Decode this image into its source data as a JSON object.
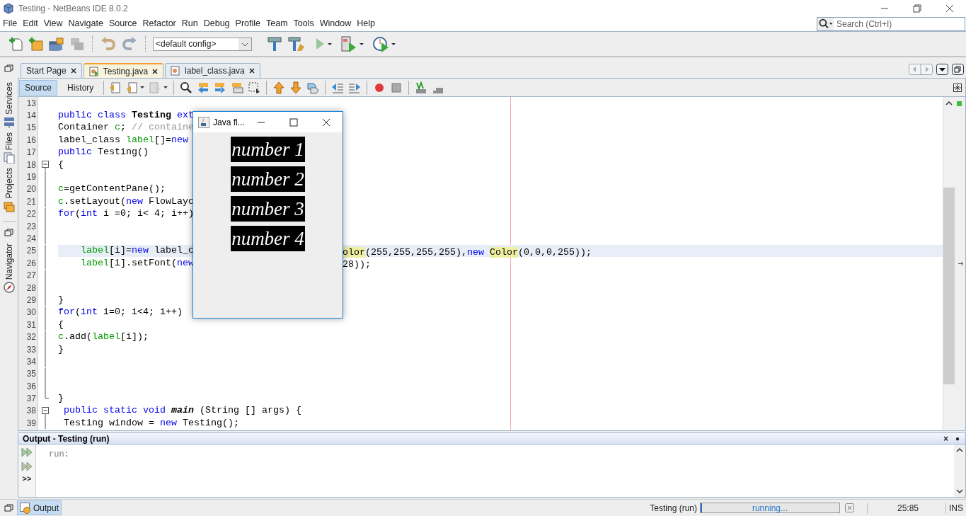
{
  "window": {
    "title": "Testing - NetBeans IDE 8.0.2"
  },
  "menu": [
    "File",
    "Edit",
    "View",
    "Navigate",
    "Source",
    "Refactor",
    "Run",
    "Debug",
    "Profile",
    "Team",
    "Tools",
    "Window",
    "Help"
  ],
  "search": {
    "placeholder": "Search (Ctrl+I)"
  },
  "toolbar": {
    "config": "<default config>"
  },
  "side_tabs": [
    {
      "label": "Services"
    },
    {
      "label": "Files"
    },
    {
      "label": "Projects"
    },
    {
      "label": "Navigator"
    }
  ],
  "editor_tabs": [
    {
      "label": "Start Page",
      "selected": false
    },
    {
      "label": "Testing.java",
      "selected": true
    },
    {
      "label": "label_class.java",
      "selected": false
    }
  ],
  "view_tabs": [
    {
      "label": "Source",
      "selected": true
    },
    {
      "label": "History",
      "selected": false
    }
  ],
  "code_lines": [
    {
      "number": "13",
      "kind": "plain",
      "current": false
    },
    {
      "number": "14",
      "kind": "plain",
      "current": false,
      "left": [
        {
          "text": "public class ",
          "kind": "kw"
        },
        {
          "text": "Testing",
          "kind": "bold"
        },
        {
          "text": " ext",
          "kind": "kw"
        }
      ]
    },
    {
      "number": "15",
      "kind": "plain",
      "current": false,
      "left": [
        {
          "text": "Container ",
          "kind": "plain"
        },
        {
          "text": "c",
          "kind": "field"
        },
        {
          "text": "; ",
          "kind": "plain"
        },
        {
          "text": "// containe",
          "kind": "comment"
        }
      ]
    },
    {
      "number": "16",
      "kind": "plain",
      "current": false,
      "left": [
        {
          "text": "label_class ",
          "kind": "plain"
        },
        {
          "text": "label",
          "kind": "field"
        },
        {
          "text": "[]=",
          "kind": "plain"
        },
        {
          "text": "new",
          "kind": "kw"
        }
      ]
    },
    {
      "number": "17",
      "kind": "plain",
      "current": false,
      "left": [
        {
          "text": "public ",
          "kind": "kw"
        },
        {
          "text": "Testing()",
          "kind": "plain"
        }
      ]
    },
    {
      "number": "18",
      "kind": "fold_start",
      "current": false,
      "left": [
        {
          "text": "{",
          "kind": "plain"
        }
      ]
    },
    {
      "number": "19",
      "kind": "fold_body",
      "current": false
    },
    {
      "number": "20",
      "kind": "fold_body",
      "current": false,
      "left": [
        {
          "text": "c",
          "kind": "field"
        },
        {
          "text": "=getContentPane();",
          "kind": "plain"
        }
      ]
    },
    {
      "number": "21",
      "kind": "fold_body",
      "current": false,
      "left": [
        {
          "text": "c",
          "kind": "field"
        },
        {
          "text": ".setLayout(",
          "kind": "plain"
        },
        {
          "text": "new",
          "kind": "kw"
        },
        {
          "text": " FlowLayo",
          "kind": "plain"
        }
      ]
    },
    {
      "number": "22",
      "kind": "fold_body",
      "current": false,
      "left": [
        {
          "text": "for",
          "kind": "kw"
        },
        {
          "text": "(",
          "kind": "plain"
        },
        {
          "text": "int",
          "kind": "kw"
        },
        {
          "text": " i =0; i< 4; i++)",
          "kind": "plain"
        }
      ]
    },
    {
      "number": "23",
      "kind": "fold_body",
      "current": false
    },
    {
      "number": "24",
      "kind": "fold_body",
      "current": false
    },
    {
      "number": "25",
      "kind": "fold_body",
      "current": true,
      "left": [
        {
          "text": "    label",
          "kind": "field"
        },
        {
          "text": "[i]=",
          "kind": "plain"
        },
        {
          "text": "new",
          "kind": "kw"
        },
        {
          "text": " label_c",
          "kind": "plain"
        }
      ],
      "right": [
        {
          "text": "olor",
          "kind": "mark"
        },
        {
          "text": "(255,255,255,255),",
          "kind": "plain"
        },
        {
          "text": "new ",
          "kind": "kw"
        },
        {
          "text": "Color",
          "kind": "mark"
        },
        {
          "text": "(0,0,0,255));",
          "kind": "plain"
        }
      ]
    },
    {
      "number": "26",
      "kind": "fold_body",
      "current": false,
      "left": [
        {
          "text": "    label",
          "kind": "field"
        },
        {
          "text": "[i].setFont(",
          "kind": "plain"
        },
        {
          "text": "new",
          "kind": "kw"
        }
      ],
      "right": [
        {
          "text": "28));",
          "kind": "plain"
        }
      ]
    },
    {
      "number": "27",
      "kind": "fold_body",
      "current": false
    },
    {
      "number": "28",
      "kind": "fold_body",
      "current": false
    },
    {
      "number": "29",
      "kind": "fold_body",
      "current": false,
      "left": [
        {
          "text": "}",
          "kind": "plain"
        }
      ]
    },
    {
      "number": "30",
      "kind": "fold_body",
      "current": false,
      "left": [
        {
          "text": "for",
          "kind": "kw"
        },
        {
          "text": "(",
          "kind": "plain"
        },
        {
          "text": "int",
          "kind": "kw"
        },
        {
          "text": " i=0; i<4; i++)",
          "kind": "plain"
        }
      ]
    },
    {
      "number": "31",
      "kind": "fold_body",
      "current": false,
      "left": [
        {
          "text": "{",
          "kind": "plain"
        }
      ]
    },
    {
      "number": "32",
      "kind": "fold_body",
      "current": false,
      "left": [
        {
          "text": "c",
          "kind": "field"
        },
        {
          "text": ".add(",
          "kind": "plain"
        },
        {
          "text": "label",
          "kind": "field"
        },
        {
          "text": "[i]);",
          "kind": "plain"
        }
      ]
    },
    {
      "number": "33",
      "kind": "fold_body",
      "current": false,
      "left": [
        {
          "text": "}",
          "kind": "plain"
        }
      ]
    },
    {
      "number": "34",
      "kind": "fold_body",
      "current": false
    },
    {
      "number": "35",
      "kind": "fold_body",
      "current": false
    },
    {
      "number": "36",
      "kind": "fold_body",
      "current": false
    },
    {
      "number": "37",
      "kind": "fold_end",
      "current": false,
      "left": [
        {
          "text": "}",
          "kind": "plain"
        }
      ]
    },
    {
      "number": "38",
      "kind": "fold_start",
      "current": false,
      "left": [
        {
          "text": " public static void ",
          "kind": "kw"
        },
        {
          "text": "main",
          "kind": "boldit"
        },
        {
          "text": " (String [] args) {",
          "kind": "plain"
        }
      ]
    },
    {
      "number": "39",
      "kind": "fold_body",
      "current": false,
      "left": [
        {
          "text": " Testing window = ",
          "kind": "plain"
        },
        {
          "text": "new",
          "kind": "kw"
        },
        {
          "text": " Testing();",
          "kind": "plain"
        }
      ]
    }
  ],
  "java_window": {
    "title": "Java fl...",
    "labels": [
      "number 1",
      "number 2",
      "number 3",
      "number 4"
    ]
  },
  "output": {
    "title": "Output - Testing (run)",
    "rail_text": ">>",
    "lines": [
      "run:"
    ],
    "close": "×",
    "pin": "●"
  },
  "bottom_tabs": [
    {
      "label": "Output",
      "selected": true
    }
  ],
  "status_bar": {
    "task": "Testing (run)",
    "progress": "running...",
    "level": 0.01,
    "position": "25:85",
    "mode": "INS"
  }
}
